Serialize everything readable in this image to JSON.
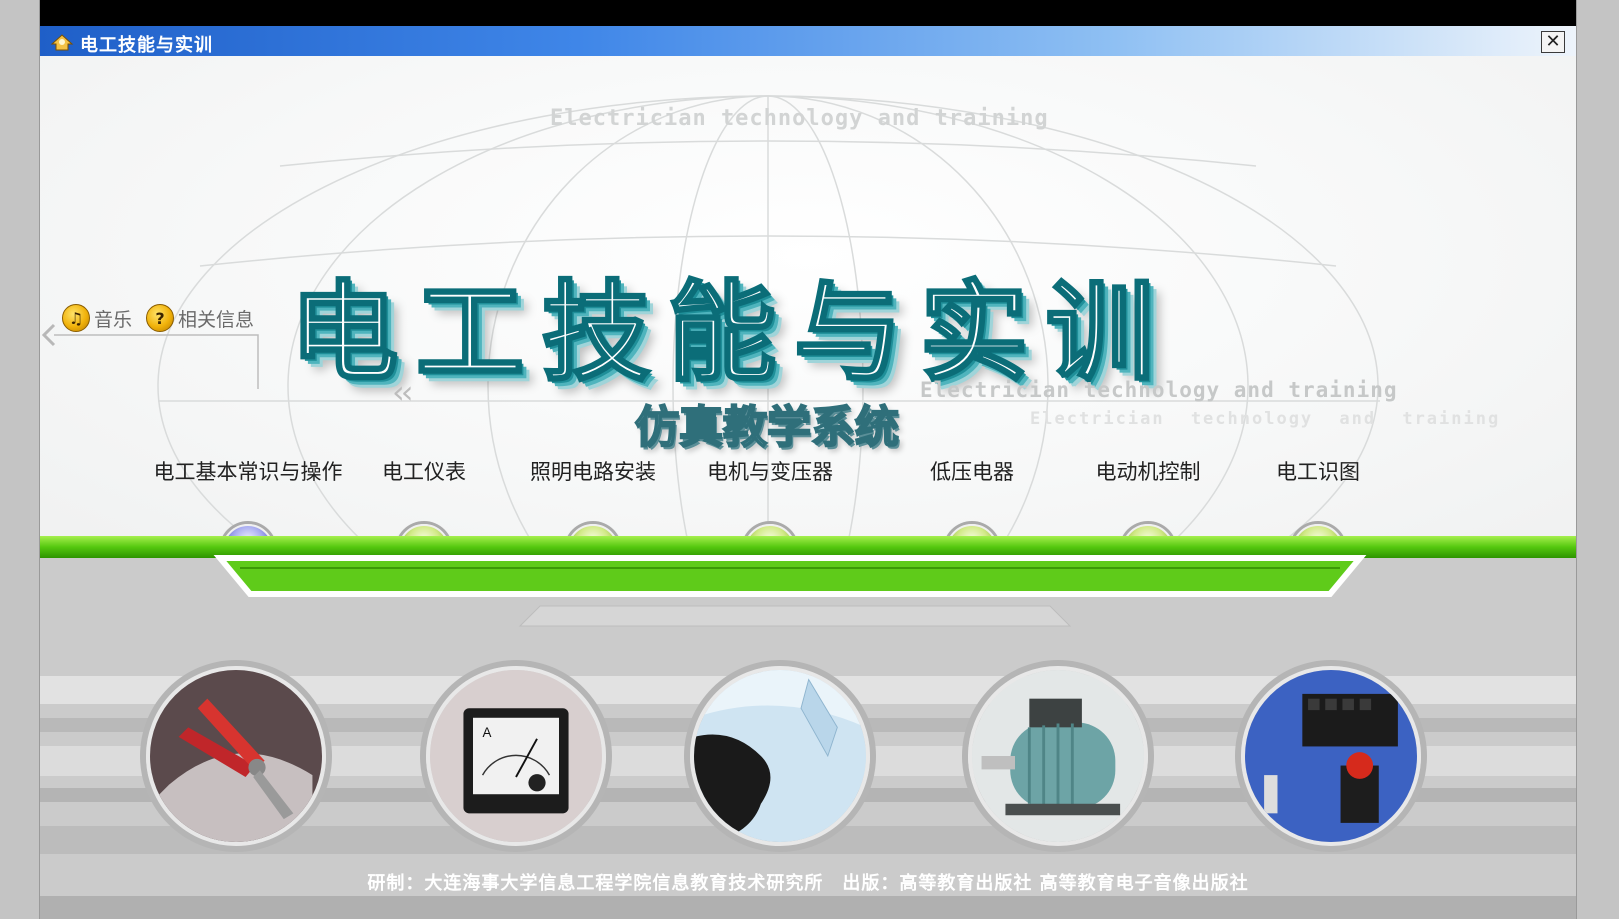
{
  "window": {
    "title": "电工技能与实训",
    "close_glyph": "✕"
  },
  "header": {
    "en_watermark_top": "Electrician technology and training",
    "main_title": "电工技能与实训",
    "en_watermark_mid": "Electrician technology and training",
    "subtitle": "仿真教学系统",
    "en_watermark_low": "Electrician technology and training"
  },
  "side_buttons": {
    "music": {
      "icon": "music-note-icon",
      "glyph": "♫",
      "label": "音乐"
    },
    "info": {
      "icon": "question-icon",
      "glyph": "?",
      "label": "相关信息"
    }
  },
  "nav": [
    {
      "label": "电工基本常识与操作",
      "active": true
    },
    {
      "label": "电工仪表",
      "active": false
    },
    {
      "label": "照明电路安装",
      "active": false
    },
    {
      "label": "电机与变压器",
      "active": false
    },
    {
      "label": "低压电器",
      "active": false
    },
    {
      "label": "电动机控制",
      "active": false
    },
    {
      "label": "电工识图",
      "active": false
    }
  ],
  "colors": {
    "accent_green": "#55c80f",
    "title_teal": "#0b6d78",
    "titlebar_blue": "#1f5fc8",
    "orb_active": "#4e52c6",
    "orb_default": "#8cb72d"
  },
  "footer": {
    "text": "研制：大连海事大学信息工程学院信息教育技术研究所　出版：高等教育出版社 高等教育电子音像出版社"
  }
}
